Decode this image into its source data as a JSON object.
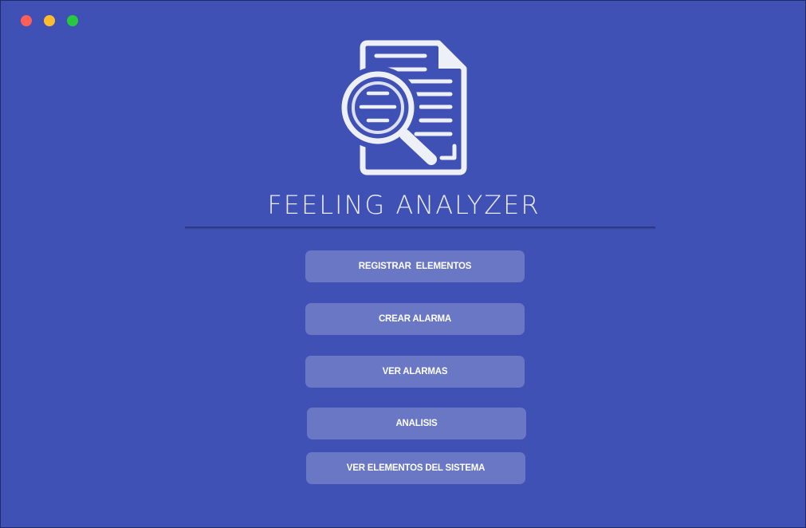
{
  "window": {
    "controls": [
      "close",
      "minimize",
      "maximize"
    ],
    "colors": {
      "background": "#3f51b5",
      "close": "#ff5f57",
      "minimize": "#febc2e",
      "maximize": "#28c840"
    }
  },
  "app": {
    "title": "FEELING ANALYZER",
    "logo_icon": "document-search-icon"
  },
  "menu": {
    "registrar_label": "REGISTRAR  ELEMENTOS",
    "crear_alarma_label": "CREAR ALARMA",
    "ver_alarmas_label": "VER ALARMAS",
    "analisis_label": "ANALISIS",
    "ver_elementos_label": "VER ELEMENTOS DEL SISTEMA"
  }
}
